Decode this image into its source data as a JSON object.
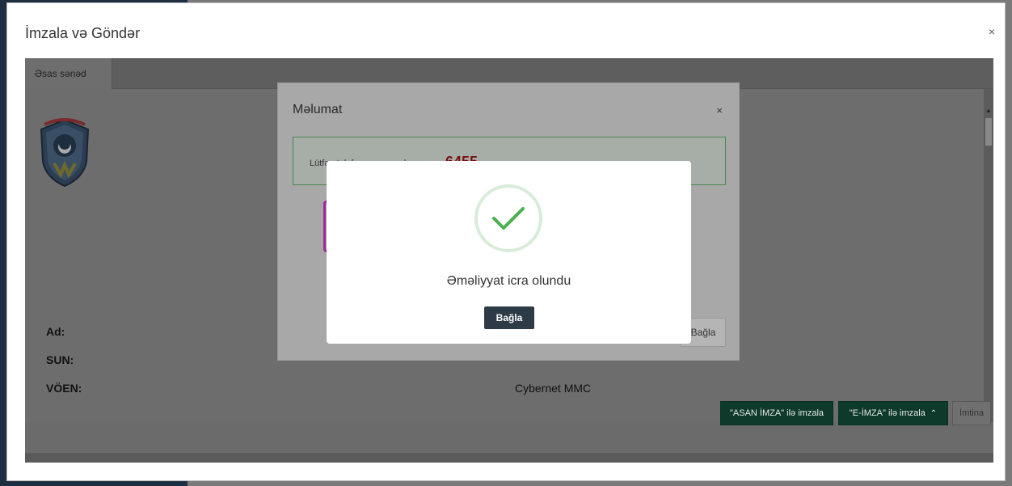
{
  "outer_modal": {
    "title": "İmzala və Göndər",
    "close": "×"
  },
  "tabs": [
    {
      "label": "Əsas sənəd"
    }
  ],
  "document": {
    "rows": [
      {
        "label": "Ad:",
        "value": ""
      },
      {
        "label": "SUN:",
        "value": ""
      },
      {
        "label": "VÖEN:",
        "value": "Cybernet MMC"
      }
    ]
  },
  "buttons": {
    "asan": "\"ASAN İMZA\" ilə imzala",
    "eimza": "\"E-İMZA\" ilə imzala",
    "eimza_caret": "^",
    "imtina": "İmtina"
  },
  "info_modal": {
    "title": "Məlumat",
    "close": "×",
    "alert_text": "Lütfən telefonunuzu yoxlayın",
    "code": "6455",
    "close_button": "Bağla"
  },
  "success": {
    "message": "Əməliyyat icra olundu",
    "button": "Bağla"
  },
  "colors": {
    "success_green": "#4caf50",
    "dark_green_button": "#0d3a2a",
    "dark_button": "#2d3b47"
  }
}
